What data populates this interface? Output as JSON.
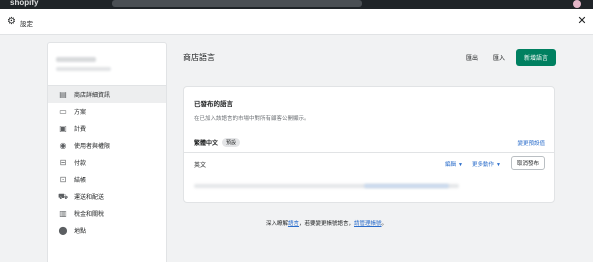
{
  "topbar": {
    "brand": "shopify"
  },
  "modal": {
    "title": "設定"
  },
  "sidebar": {
    "items": [
      {
        "label": "商店詳細資訊",
        "icon": "store-icon",
        "glyph": "▤"
      },
      {
        "label": "方案",
        "icon": "plan-icon",
        "glyph": "▭"
      },
      {
        "label": "計費",
        "icon": "billing-icon",
        "glyph": "▣"
      },
      {
        "label": "使用者與權限",
        "icon": "users-icon",
        "glyph": "◉"
      },
      {
        "label": "付款",
        "icon": "payments-icon",
        "glyph": "⊟"
      },
      {
        "label": "結帳",
        "icon": "checkout-icon",
        "glyph": "⊡"
      },
      {
        "label": "運送和配送",
        "icon": "shipping-icon",
        "glyph": "⛟"
      },
      {
        "label": "稅金和關稅",
        "icon": "taxes-icon",
        "glyph": "▥"
      },
      {
        "label": "地點",
        "icon": "location-icon",
        "glyph": "⬤"
      }
    ]
  },
  "page": {
    "title": "商店語言",
    "export_label": "匯出",
    "import_label": "匯入",
    "add_language_label": "新增語言"
  },
  "card": {
    "title": "已發布的語言",
    "description": "在已加入該語言的市場中對所有顧客公開顯示。",
    "default_language": "繁體中文",
    "default_badge": "預設",
    "change_default_link": "變更預設值",
    "secondary_language": "英文",
    "edit_label": "編輯",
    "more_actions_label": "更多動作",
    "unpublish_label": "取消發布"
  },
  "footer": {
    "prefix": "深入瞭解",
    "languages_link": "語言",
    "middle": "，若要變更帳號語言，",
    "manage_account_link": "請管理帳號",
    "suffix": "。"
  },
  "colors": {
    "primary": "#008060",
    "link": "#2c6ecb"
  }
}
